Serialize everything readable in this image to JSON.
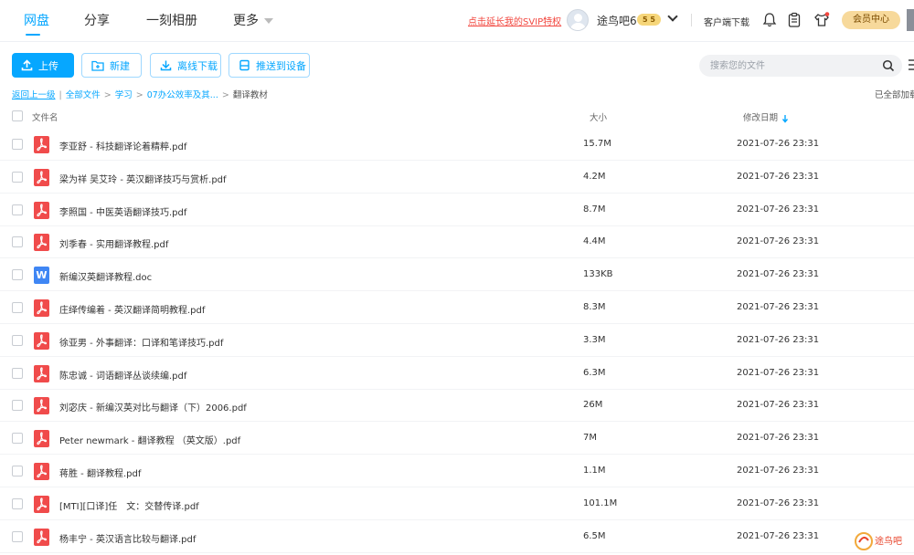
{
  "nav": {
    "tabs": [
      {
        "label": "网盘",
        "active": true
      },
      {
        "label": "分享",
        "active": false
      },
      {
        "label": "一刻相册",
        "active": false
      },
      {
        "label": "更多",
        "active": false
      }
    ]
  },
  "header": {
    "svip_link": "点击延长我的SVIP特权",
    "username": "途鸟吧6",
    "vip_badge": "5 5",
    "client_download": "客户端下载",
    "vip_center": "会员中心",
    "icons": [
      "bell-icon",
      "clipboard-icon",
      "shirt-icon"
    ]
  },
  "toolbar": {
    "upload": "上传",
    "new": "新建",
    "offline_download": "离线下载",
    "push_to_device": "推送到设备",
    "search_placeholder": "搜索您的文件"
  },
  "breadcrumb": {
    "back": "返回上一级",
    "items": [
      "全部文件",
      "学习",
      "07办公效率及其...",
      "翻译教材"
    ],
    "loaded_status": "已全部加载"
  },
  "table": {
    "columns": {
      "name": "文件名",
      "size": "大小",
      "date": "修改日期"
    },
    "sort": {
      "column": "date",
      "direction": "desc"
    },
    "rows": [
      {
        "name": "李亚舒 - 科技翻译论着精粹.pdf",
        "type": "pdf",
        "size": "15.7M",
        "date": "2021-07-26 23:31"
      },
      {
        "name": "梁为祥 吴艾玲 - 英汉翻译技巧与赏析.pdf",
        "type": "pdf",
        "size": "4.2M",
        "date": "2021-07-26 23:31"
      },
      {
        "name": "李照国 - 中医英语翻译技巧.pdf",
        "type": "pdf",
        "size": "8.7M",
        "date": "2021-07-26 23:31"
      },
      {
        "name": "刘季春 - 实用翻译教程.pdf",
        "type": "pdf",
        "size": "4.4M",
        "date": "2021-07-26 23:31"
      },
      {
        "name": "新编汉英翻译教程.doc",
        "type": "doc",
        "size": "133KB",
        "date": "2021-07-26 23:31"
      },
      {
        "name": "庄绎传编着 - 英汉翻译简明教程.pdf",
        "type": "pdf",
        "size": "8.3M",
        "date": "2021-07-26 23:31"
      },
      {
        "name": "徐亚男 - 外事翻译：口译和笔译技巧.pdf",
        "type": "pdf",
        "size": "3.3M",
        "date": "2021-07-26 23:31"
      },
      {
        "name": "陈忠诚 - 词语翻译丛谈续编.pdf",
        "type": "pdf",
        "size": "6.3M",
        "date": "2021-07-26 23:31"
      },
      {
        "name": "刘宓庆 - 新编汉英对比与翻译（下）2006.pdf",
        "type": "pdf",
        "size": "26M",
        "date": "2021-07-26 23:31"
      },
      {
        "name": "Peter newmark - 翻译教程 （英文版）.pdf",
        "type": "pdf",
        "size": "7M",
        "date": "2021-07-26 23:31"
      },
      {
        "name": "蒋胜 - 翻译教程.pdf",
        "type": "pdf",
        "size": "1.1M",
        "date": "2021-07-26 23:31"
      },
      {
        "name": "[MTI][口译]任　文：交替传译.pdf",
        "type": "pdf",
        "size": "101.1M",
        "date": "2021-07-26 23:31"
      },
      {
        "name": "杨丰宁 - 英汉语言比较与翻译.pdf",
        "type": "pdf",
        "size": "6.5M",
        "date": "2021-07-26 23:31"
      }
    ]
  },
  "watermark": {
    "text": "途鸟吧"
  },
  "colors": {
    "accent": "#06a7ff",
    "pdf": "#f04b4b",
    "doc": "#3f86f4",
    "svip_link": "#f2473f",
    "vip_gold": "#f7d99b"
  }
}
